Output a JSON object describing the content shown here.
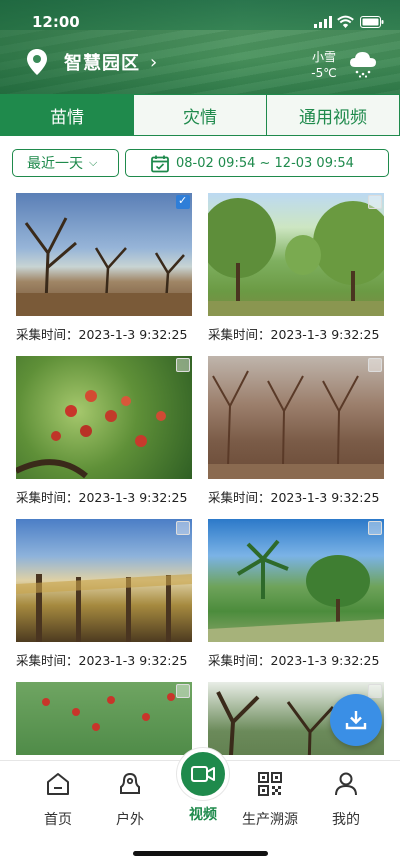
{
  "status_bar": {
    "time": "12:00"
  },
  "header": {
    "location": "智慧园区",
    "weather": {
      "condition": "小雪",
      "temperature": "-5℃"
    }
  },
  "tabs": [
    {
      "label": "苗情",
      "active": true
    },
    {
      "label": "灾情",
      "active": false
    },
    {
      "label": "通用视频",
      "active": false
    }
  ],
  "filters": {
    "range_label": "最近一天",
    "date_range": "08-02 09:54 ~ 12-03 09:54"
  },
  "photos": [
    {
      "caption": "采集时间：2023-1-3   9:32:25",
      "checked": true
    },
    {
      "caption": "采集时间：2023-1-3   9:32:25",
      "checked": false
    },
    {
      "caption": "采集时间：2023-1-3   9:32:25",
      "checked": false
    },
    {
      "caption": "采集时间：2023-1-3   9:32:25",
      "checked": false
    },
    {
      "caption": "采集时间：2023-1-3   9:32:25",
      "checked": false
    },
    {
      "caption": "采集时间：2023-1-3   9:32:25",
      "checked": false
    },
    {
      "caption": "",
      "checked": false
    },
    {
      "caption": "",
      "checked": false
    }
  ],
  "bottom_nav": {
    "items": [
      {
        "label": "首页",
        "icon": "home-icon"
      },
      {
        "label": "户外",
        "icon": "outdoor-icon"
      },
      {
        "label": "视频",
        "icon": "video-icon",
        "active": true
      },
      {
        "label": "生产溯源",
        "icon": "qr-code-icon"
      },
      {
        "label": "我的",
        "icon": "profile-icon"
      }
    ]
  },
  "colors": {
    "primary": "#1f8a4c",
    "fab": "#3a8fe6",
    "check": "#2f7ed8"
  }
}
